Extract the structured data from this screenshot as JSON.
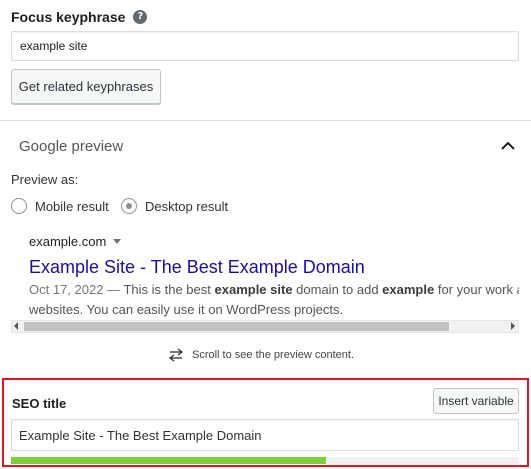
{
  "focus_keyphrase": {
    "label": "Focus keyphrase",
    "help_icon": "question-mark",
    "value": "example site",
    "related_button": "Get related keyphrases"
  },
  "google_preview": {
    "title": "Google preview",
    "collapse_icon": "chevron-up",
    "preview_as_label": "Preview as:",
    "options": [
      {
        "label": "Mobile result",
        "checked": false
      },
      {
        "label": "Desktop result",
        "checked": true
      }
    ],
    "url": "example.com",
    "serp_title": "Example Site - The Best Example Domain",
    "date": "Oct 17, 2022",
    "description_parts": {
      "dash": " — ",
      "p1": "This is the best ",
      "b1": "example site",
      "p2": " domain to add ",
      "b2": "example",
      "p3": " for your work abc",
      "line2": "websites. You can easily use it on WordPress projects."
    },
    "scroll_hint": "Scroll to see the preview content.",
    "scroll_icon": "swap-arrows"
  },
  "seo_title": {
    "label": "SEO title",
    "insert_button": "Insert variable",
    "value": "Example Site - The Best Example Domain",
    "progress": 0.62,
    "progress_color": "#7ad03a",
    "highlight_color": "#e3141b"
  }
}
